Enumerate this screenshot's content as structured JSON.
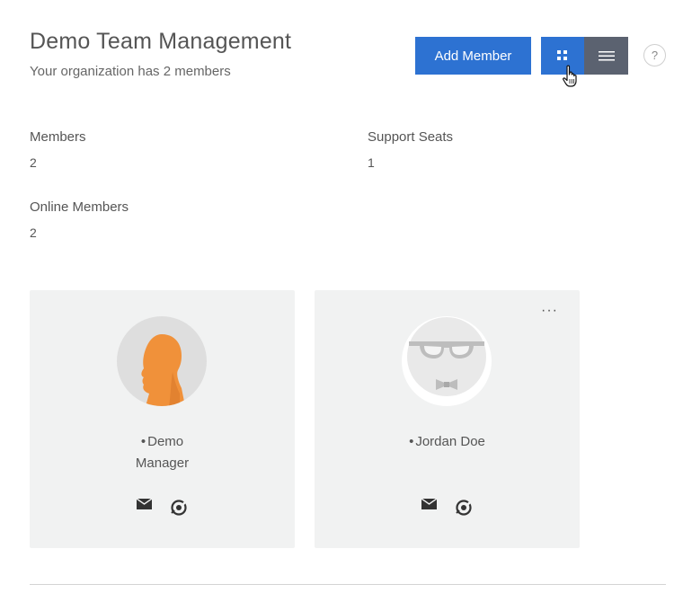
{
  "header": {
    "title": "Demo Team Management",
    "subtitle": "Your organization has 2 members"
  },
  "toolbar": {
    "add_member_label": "Add Member",
    "help_label": "?"
  },
  "stats": [
    {
      "label": "Members",
      "value": "2"
    },
    {
      "label": "Support Seats",
      "value": "1"
    },
    {
      "label": "Online Members",
      "value": "2"
    }
  ],
  "members": [
    {
      "name_line1": "Demo",
      "name_line2": "Manager"
    },
    {
      "name_line1": "Jordan Doe",
      "more_label": "···"
    }
  ],
  "colors": {
    "accent": "#2d72d2",
    "toggle_inactive": "#5b6270",
    "card_bg": "#f1f2f2",
    "avatar_orange": "#f0913a"
  }
}
